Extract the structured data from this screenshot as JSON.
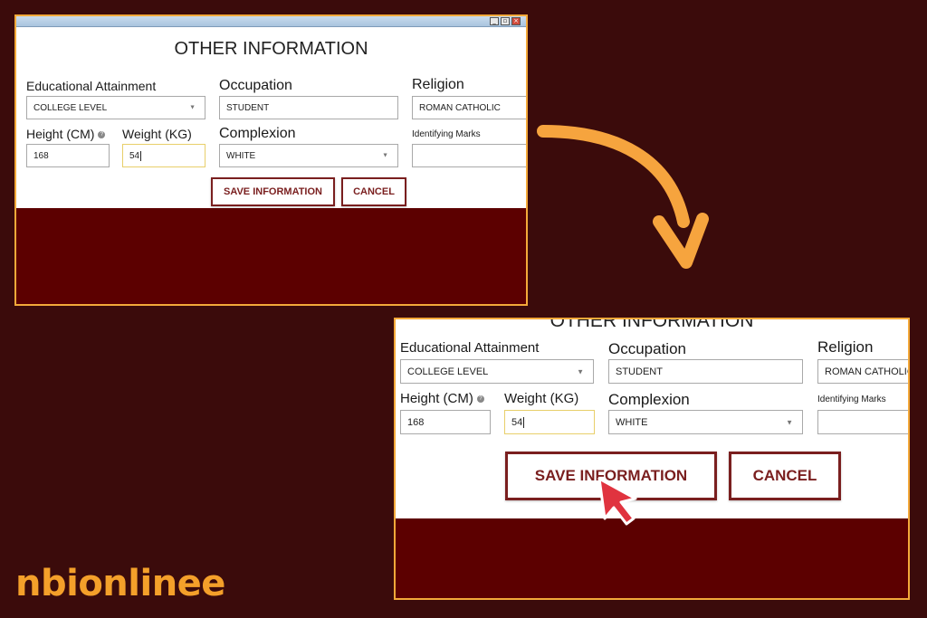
{
  "form": {
    "title": "OTHER INFORMATION",
    "educational_attainment": {
      "label": "Educational Attainment",
      "value": "COLLEGE LEVEL"
    },
    "occupation": {
      "label": "Occupation",
      "value": "STUDENT"
    },
    "religion": {
      "label": "Religion",
      "value": "ROMAN CATHOLIC"
    },
    "height": {
      "label": "Height (CM)",
      "value": "168"
    },
    "weight": {
      "label": "Weight (KG)",
      "value": "54"
    },
    "complexion": {
      "label": "Complexion",
      "value": "WHITE"
    },
    "identifying_marks": {
      "label": "Identifying Marks",
      "value": ""
    },
    "save_label": "SAVE INFORMATION",
    "cancel_label": "CANCEL"
  },
  "icons": {
    "dropdown": "chevron-down-icon",
    "help": "help-icon",
    "cursor": "mouse-pointer-icon",
    "arrow": "curved-arrow-icon"
  },
  "brand": {
    "logo_text": "nbionlinee"
  },
  "colors": {
    "background": "#3b0b0b",
    "panel_border": "#f4a93a",
    "accent": "#7a1f1f",
    "arrow": "#f6a43e",
    "logo": "#f4a02a",
    "cursor": "#e0333f"
  }
}
